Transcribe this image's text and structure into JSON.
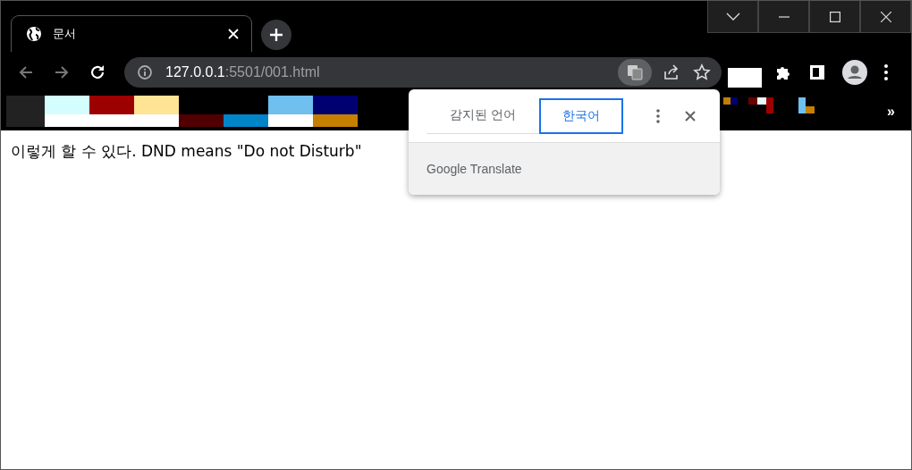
{
  "window": {
    "controls": [
      {
        "kind": "dropdown"
      },
      {
        "kind": "minimize"
      },
      {
        "kind": "maximize"
      },
      {
        "kind": "close"
      }
    ]
  },
  "tabs": [
    {
      "title": "문서",
      "selected": true
    }
  ],
  "address_bar": {
    "host": "127.0.0.1",
    "path": ":5501/001.html"
  },
  "bookmarks_bar": {
    "overflow": "»"
  },
  "page": {
    "text": "이렇게 할 수 있다. DND means \"Do not Disturb\""
  },
  "translate_popup": {
    "languages": [
      {
        "label": "감지된 언어",
        "selected": false
      },
      {
        "label": "한국어",
        "selected": true
      }
    ],
    "footer": "Google Translate"
  }
}
